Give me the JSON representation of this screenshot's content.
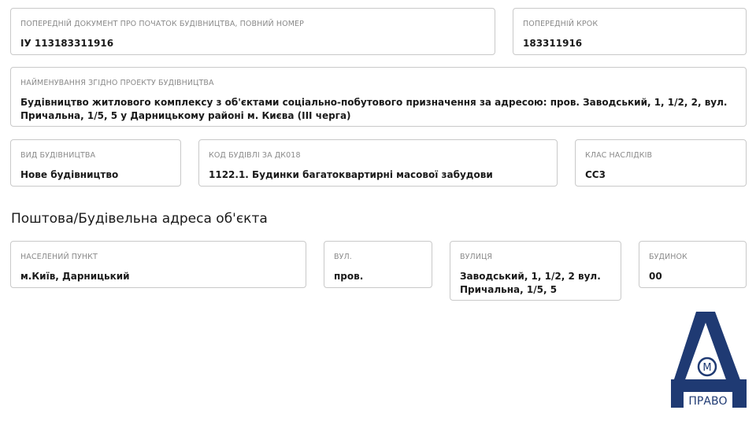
{
  "fields": {
    "prev_doc": {
      "label": "ПОПЕРЕДНІЙ ДОКУМЕНТ ПРО ПОЧАТОК БУДІВНИЦТВА, ПОВНИЙ НОМЕР",
      "value": "ІУ 113183311916"
    },
    "prev_step": {
      "label": "ПОПЕРЕДНІЙ КРОК",
      "value": "183311916"
    },
    "project_name": {
      "label": "НАЙМЕНУВАННЯ ЗГІДНО ПРОЕКТУ БУДІВНИЦТВА",
      "value": "Будівництво житлового комплексу з об'єктами соціально-побутового призначення за адресою: пров. Заводський, 1, 1/2, 2, вул. Причальна, 1/5, 5 у Дарницькому районі м. Києва (III черга)"
    },
    "construction_type": {
      "label": "ВИД БУДІВНИЦТВА",
      "value": "Нове будівництво"
    },
    "building_code": {
      "label": "КОД БУДІВЛІ ЗА ДК018",
      "value": "1122.1. Будинки багатоквартирні масової забудови"
    },
    "consequence_class": {
      "label": "КЛАС НАСЛІДКІВ",
      "value": "СС3"
    }
  },
  "address_section": {
    "title": "Поштова/Будівельна адреса об'єкта",
    "settlement": {
      "label": "НАСЕЛЕНИЙ ПУНКТ",
      "value": "м.Київ, Дарницький"
    },
    "street_type": {
      "label": "ВУЛ.",
      "value": "пров."
    },
    "street": {
      "label": "ВУЛИЦЯ",
      "value": "Заводський, 1, 1/2, 2 вул. Причальна, 1/5, 5"
    },
    "building": {
      "label": "БУДИНОК",
      "value": "00"
    }
  },
  "logo": {
    "text": "ПРАВО",
    "letter": "А",
    "emblem": "М",
    "color": "#1f3a73"
  }
}
